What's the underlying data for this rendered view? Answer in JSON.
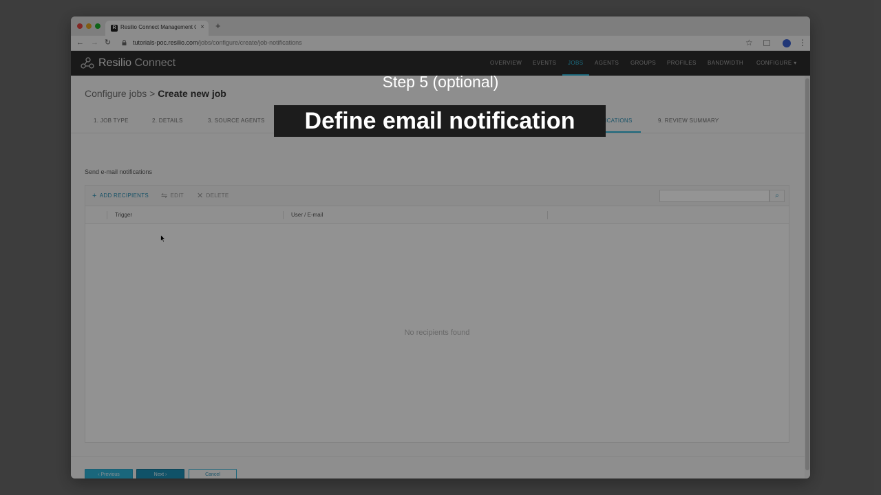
{
  "browser": {
    "tab_title": "Resilio Connect Management C...",
    "tab_favicon": "R",
    "tab_close": "×",
    "new_tab": "+",
    "url_host": "tutorials-poc.resilio.com",
    "url_path": "/jobs/configure/create/job-notifications",
    "back": "←",
    "forward": "→",
    "reload": "↻",
    "star": "☆",
    "menu": "⋮"
  },
  "app": {
    "logo_bold": "Resilio",
    "logo_light": " Connect",
    "nav": [
      {
        "label": "OVERVIEW"
      },
      {
        "label": "EVENTS"
      },
      {
        "label": "JOBS"
      },
      {
        "label": "AGENTS"
      },
      {
        "label": "GROUPS"
      },
      {
        "label": "PROFILES"
      },
      {
        "label": "BANDWIDTH"
      },
      {
        "label": "CONFIGURE ▾"
      }
    ],
    "active_nav": "JOBS"
  },
  "page": {
    "breadcrumb_parent": "Configure jobs",
    "breadcrumb_sep": " > ",
    "breadcrumb_current": "Create new job",
    "steps": [
      {
        "label": "1. JOB TYPE"
      },
      {
        "label": "2. DETAILS"
      },
      {
        "label": "3. SOURCE AGENTS"
      },
      {
        "label": "ICATIONS"
      },
      {
        "label": "9. REVIEW SUMMARY"
      }
    ],
    "active_step": "ICATIONS",
    "section_title": "Send e-mail notifications",
    "toolbar": {
      "add": "ADD RECIPIENTS",
      "edit": "EDIT",
      "delete": "DELETE",
      "add_icon": "+",
      "edit_icon": "⇋",
      "delete_icon": "✕",
      "search_icon": "⌕"
    },
    "table": {
      "columns": [
        "Trigger",
        "User / E-mail"
      ],
      "empty_text": "No recipients found"
    },
    "buttons": {
      "previous": "‹ Previous",
      "next": "Next ›",
      "cancel": "Cancel"
    }
  },
  "overlay": {
    "step_caption": "Step 5 (optional)",
    "main_caption": "Define email notification"
  },
  "colors": {
    "accent": "#2fb6d8",
    "header_bg": "#2b2b2b",
    "caption_bg": "#1c1c1c"
  }
}
